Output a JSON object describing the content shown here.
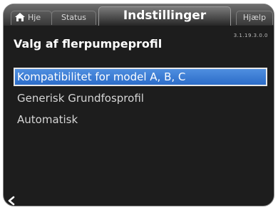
{
  "tabs": {
    "home_label": "Hje",
    "status_label": "Status",
    "settings_label": "Indstillinger",
    "help_label": "Hjælp"
  },
  "header": {
    "title": "Valg af flerpumpeprofil",
    "menu_id": "3.1.19.3.0.0"
  },
  "list": {
    "items": [
      {
        "label": "Kompatibilitet for model A, B, C",
        "selected": true
      },
      {
        "label": "Generisk Grundfosprofil",
        "selected": false
      },
      {
        "label": "Automatisk",
        "selected": false
      }
    ]
  },
  "footer": {
    "back_icon": "chevron-left-icon"
  },
  "colors": {
    "selection": "#3a7bd5",
    "background": "#1d1d1d",
    "text": "#d6d6d6"
  }
}
